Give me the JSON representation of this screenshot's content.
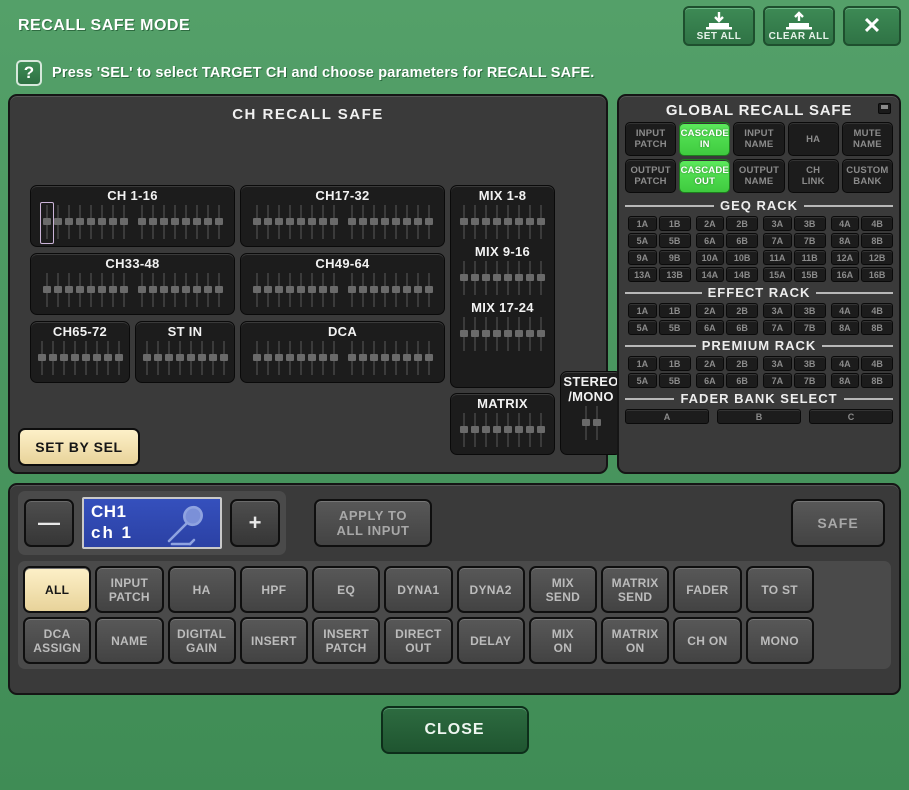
{
  "window": {
    "title": "RECALL SAFE MODE",
    "set_all_label": "SET ALL",
    "clear_all_label": "CLEAR ALL",
    "close_icon": "close-x-icon",
    "set_all_icon": "download-to-tray-icon",
    "clear_all_icon": "upload-from-tray-icon"
  },
  "help": {
    "icon": "question-mark-icon",
    "text": "Press 'SEL' to select TARGET CH and choose parameters for RECALL SAFE."
  },
  "ch_recall_safe": {
    "title": "CH RECALL SAFE",
    "set_by_sel_label": "SET BY SEL",
    "groups": [
      {
        "label": "CH 1-16",
        "faders": 16,
        "selected_index": 0
      },
      {
        "label": "CH17-32",
        "faders": 16,
        "selected_index": -1
      },
      {
        "label": "CH33-48",
        "faders": 16,
        "selected_index": -1
      },
      {
        "label": "CH49-64",
        "faders": 16,
        "selected_index": -1
      },
      {
        "label": "CH65-72",
        "faders": 8,
        "selected_index": -1
      },
      {
        "label": "ST IN",
        "faders": 8,
        "selected_index": -1
      },
      {
        "label": "DCA",
        "faders": 16,
        "selected_index": -1
      },
      {
        "label": "MIX 1-8",
        "faders": 8,
        "selected_index": -1
      },
      {
        "label": "MIX 9-16",
        "faders": 8,
        "selected_index": -1
      },
      {
        "label": "MIX 17-24",
        "faders": 8,
        "selected_index": -1
      },
      {
        "label": "MATRIX",
        "faders": 8,
        "selected_index": -1
      },
      {
        "label": "STEREO\n/MONO",
        "faders": 2,
        "selected_index": -1
      }
    ]
  },
  "global_recall_safe": {
    "title": "GLOBAL RECALL SAFE",
    "popup_icon": "popup-window-icon",
    "buttons": [
      {
        "label": "INPUT\nPATCH",
        "on": false
      },
      {
        "label": "CASCADE\nIN",
        "on": true
      },
      {
        "label": "INPUT\nNAME",
        "on": false
      },
      {
        "label": "HA",
        "on": false
      },
      {
        "label": "MUTE\nNAME",
        "on": false
      },
      {
        "label": "OUTPUT\nPATCH",
        "on": false
      },
      {
        "label": "CASCADE\nOUT",
        "on": true
      },
      {
        "label": "OUTPUT\nNAME",
        "on": false
      },
      {
        "label": "CH\nLINK",
        "on": false
      },
      {
        "label": "CUSTOM\nBANK",
        "on": false
      }
    ],
    "geq_rack": {
      "title": "GEQ RACK",
      "slots": [
        "1A",
        "1B",
        "2A",
        "2B",
        "3A",
        "3B",
        "4A",
        "4B",
        "5A",
        "5B",
        "6A",
        "6B",
        "7A",
        "7B",
        "8A",
        "8B",
        "9A",
        "9B",
        "10A",
        "10B",
        "11A",
        "11B",
        "12A",
        "12B",
        "13A",
        "13B",
        "14A",
        "14B",
        "15A",
        "15B",
        "16A",
        "16B"
      ]
    },
    "effect_rack": {
      "title": "EFFECT RACK",
      "slots": [
        "1A",
        "1B",
        "2A",
        "2B",
        "3A",
        "3B",
        "4A",
        "4B",
        "5A",
        "5B",
        "6A",
        "6B",
        "7A",
        "7B",
        "8A",
        "8B"
      ]
    },
    "premium_rack": {
      "title": "PREMIUM RACK",
      "slots": [
        "1A",
        "1B",
        "2A",
        "2B",
        "3A",
        "3B",
        "4A",
        "4B",
        "5A",
        "5B",
        "6A",
        "6B",
        "7A",
        "7B",
        "8A",
        "8B"
      ]
    },
    "fader_bank_select": {
      "title": "FADER BANK SELECT",
      "banks": [
        "A",
        "B",
        "C"
      ]
    }
  },
  "channel_selector": {
    "minus_label": "—",
    "plus_label": "+",
    "channel_name": "CH1",
    "channel_number": "ch  1",
    "channel_icon": "microphone-icon",
    "apply_label": "APPLY TO\nALL INPUT",
    "safe_label": "SAFE"
  },
  "parameters": {
    "row1": [
      {
        "label": "ALL",
        "on": true
      },
      {
        "label": "INPUT\nPATCH",
        "on": false
      },
      {
        "label": "HA",
        "on": false
      },
      {
        "label": "HPF",
        "on": false
      },
      {
        "label": "EQ",
        "on": false
      },
      {
        "label": "DYNA1",
        "on": false
      },
      {
        "label": "DYNA2",
        "on": false
      },
      {
        "label": "MIX\nSEND",
        "on": false
      },
      {
        "label": "MATRIX\nSEND",
        "on": false
      },
      {
        "label": "FADER",
        "on": false
      },
      {
        "label": "TO ST",
        "on": false
      }
    ],
    "row2": [
      {
        "label": "DCA\nASSIGN",
        "on": false
      },
      {
        "label": "NAME",
        "on": false
      },
      {
        "label": "DIGITAL\nGAIN",
        "on": false
      },
      {
        "label": "INSERT",
        "on": false
      },
      {
        "label": "INSERT\nPATCH",
        "on": false
      },
      {
        "label": "DIRECT\nOUT",
        "on": false
      },
      {
        "label": "DELAY",
        "on": false
      },
      {
        "label": "MIX\nON",
        "on": false
      },
      {
        "label": "MATRIX\nON",
        "on": false
      },
      {
        "label": "CH ON",
        "on": false
      },
      {
        "label": "MONO",
        "on": false
      }
    ]
  },
  "footer": {
    "close_label": "CLOSE"
  },
  "colors": {
    "window_bg": "#4f9c64",
    "panel_bg": "#3a3a3a",
    "button_on_green": "#4de04d",
    "button_on_cream": "#f3e3b4",
    "channel_display_blue": "#2f47b0",
    "fader_select_outline": "#cbb4d8"
  }
}
